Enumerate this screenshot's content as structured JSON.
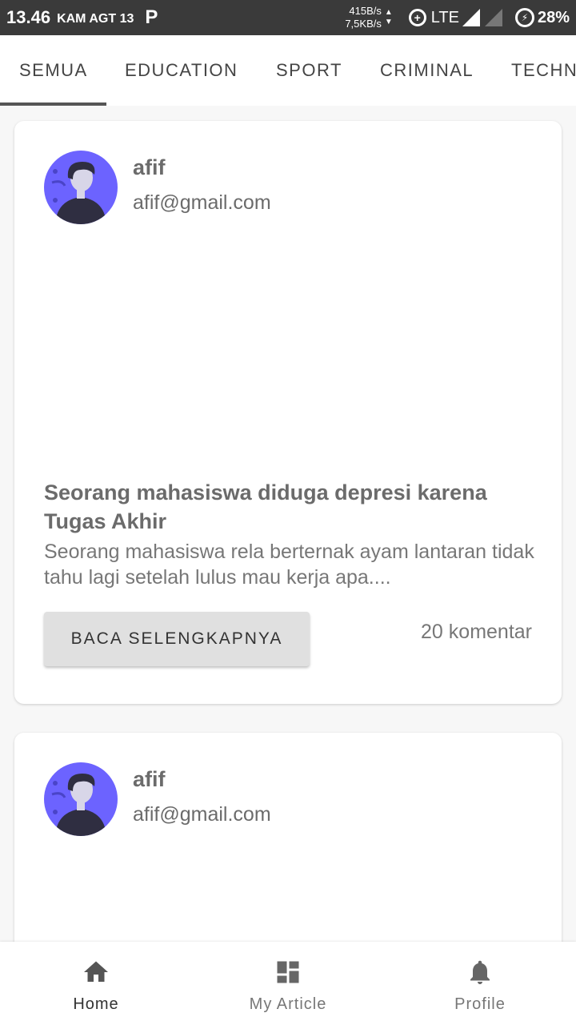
{
  "status_bar": {
    "time": "13.46",
    "date": "KAM AGT 13",
    "app_icon": "P",
    "speed_up": "415B/s",
    "speed_down": "7,5KB/s",
    "network": "LTE",
    "battery": "28%"
  },
  "tabs": [
    {
      "label": "SEMUA",
      "active": true
    },
    {
      "label": "EDUCATION",
      "active": false
    },
    {
      "label": "SPORT",
      "active": false
    },
    {
      "label": "CRIMINAL",
      "active": false
    },
    {
      "label": "TECHN",
      "active": false
    }
  ],
  "articles": [
    {
      "author": "afif",
      "email": "afif@gmail.com",
      "title": "Seorang mahasiswa diduga depresi karena Tugas Akhir",
      "excerpt": "Seorang mahasiswa rela berternak ayam lantaran tidak tahu lagi setelah lulus mau kerja apa....",
      "button": "BACA SELENGKAPNYA",
      "comments": "20 komentar"
    },
    {
      "author": "afif",
      "email": "afif@gmail.com"
    }
  ],
  "bottom_nav": [
    {
      "label": "Home",
      "icon": "home-icon",
      "active": true
    },
    {
      "label": "My Article",
      "icon": "dashboard-icon",
      "active": false
    },
    {
      "label": "Profile",
      "icon": "bell-icon",
      "active": false
    }
  ],
  "colors": {
    "status_bar_bg": "#3a3a3a",
    "avatar_bg": "#6c63ff",
    "tab_indicator": "#555555",
    "button_bg": "#e0e0e0"
  }
}
